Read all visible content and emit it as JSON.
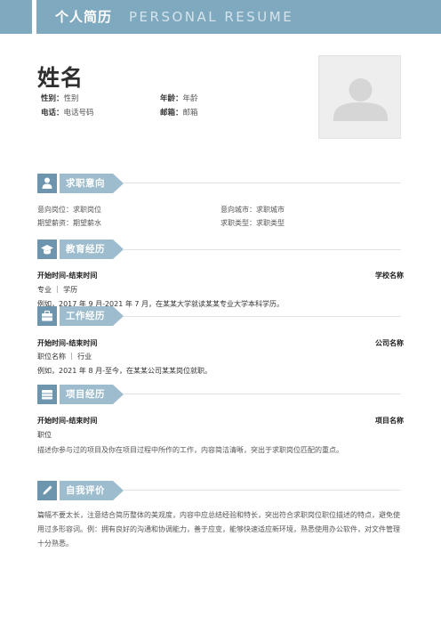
{
  "header": {
    "title_cn": "个人简历",
    "title_en": "PERSONAL RESUME"
  },
  "profile": {
    "name": "姓名",
    "gender_label": "性别：",
    "gender_value": "性别",
    "age_label": "年龄：",
    "age_value": "年龄",
    "phone_label": "电话：",
    "phone_value": "电话号码",
    "email_label": "邮箱：",
    "email_value": "邮箱",
    "photo_icon": "avatar-placeholder"
  },
  "sections": {
    "job": {
      "title": "求职意向",
      "icon": "person-icon",
      "position": "意向岗位：求职岗位",
      "city": "意向城市：求职城市",
      "salary": "期望薪资：期望薪水",
      "type": "求职类型：求职类型"
    },
    "education": {
      "title": "教育经历",
      "icon": "graduation-cap-icon",
      "time": "开始时间-结束时间",
      "school": "学校名称",
      "major": "专业 ｜ 学历",
      "desc": "例如，2017 年 9 月-2021 年 7 月，在某某大学就读某某专业大学本科学历。"
    },
    "work": {
      "title": "工作经历",
      "icon": "briefcase-icon",
      "time": "开始时间-结束时间",
      "company": "公司名称",
      "position": "职位名称 ｜ 行业",
      "desc": "例如，2021 年 8 月-至今，在某某公司某某岗位就职。"
    },
    "project": {
      "title": "项目经历",
      "icon": "folder-icon",
      "time": "开始时间-结束时间",
      "name": "项目名称",
      "role": "职位",
      "desc": "描述你参与过的项目及你在项目过程中所作的工作，内容简洁清晰，突出于求职岗位匹配的重点。"
    },
    "self": {
      "title": "自我评价",
      "icon": "pencil-icon",
      "desc": "篇幅不要太长，注意结合简历整体的美观度，内容中应总结经验和特长，突出符合求职岗位职位描述的特点，避免使用过多形容词。例：拥有良好的沟通和协调能力，善于应变，能够快速适应新环境，熟悉使用办公软件，对文件管理十分熟悉。"
    }
  },
  "colors": {
    "accent": "#7fa9bf",
    "icon_bg": "#6d95ad",
    "label_bg": "#9dbccd"
  }
}
